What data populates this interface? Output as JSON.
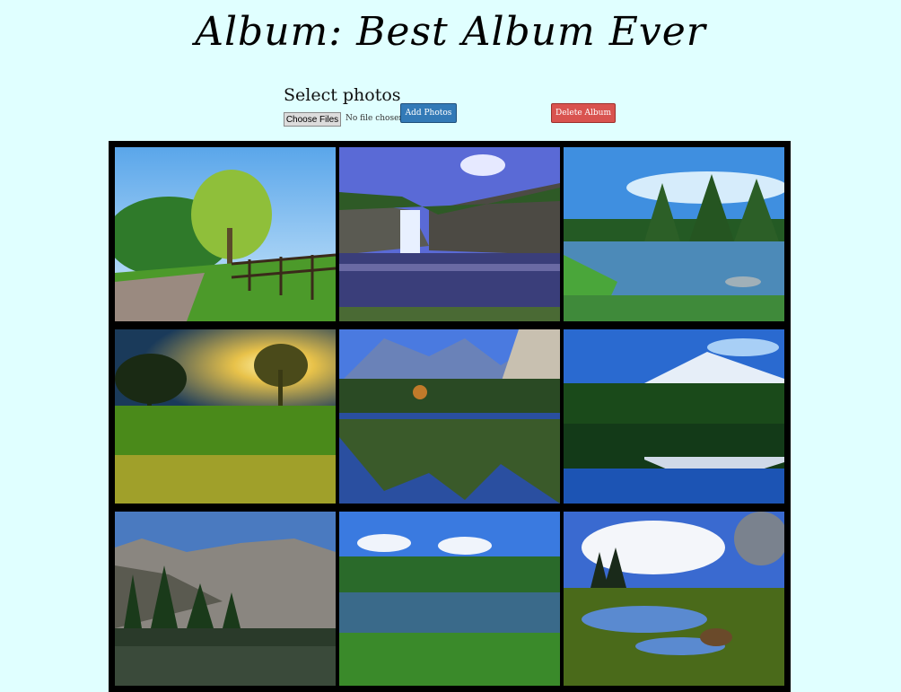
{
  "page": {
    "title": "Album: Best Album Ever"
  },
  "upload": {
    "label": "Select photos",
    "choose_files": "Choose Files",
    "no_file": "No file chosen",
    "add_photos": "Add Photos",
    "delete_album": "Delete Album"
  },
  "colors": {
    "background": "#e0ffff",
    "add_button": "#337ab7",
    "delete_button": "#d9534f",
    "gallery_background": "#000000"
  },
  "photos": [
    {
      "icon": "tree-fence-path-photo"
    },
    {
      "icon": "waterfall-photo"
    },
    {
      "icon": "lake-forest-photo"
    },
    {
      "icon": "tree-sunset-photo"
    },
    {
      "icon": "mountain-lake-reflection-photo"
    },
    {
      "icon": "snow-mountain-lake-photo"
    },
    {
      "icon": "rocky-mountain-lake-photo"
    },
    {
      "icon": "forest-pond-photo"
    },
    {
      "icon": "meadow-marsh-photo"
    }
  ]
}
